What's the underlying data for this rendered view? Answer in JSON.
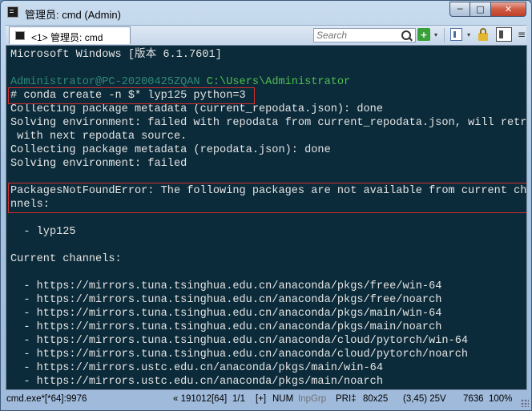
{
  "window": {
    "title": "管理员: cmd (Admin)",
    "controls": {
      "minimize": "─",
      "maximize": "□",
      "close": "✕"
    }
  },
  "toolbar": {
    "tab_label": "<1> 管理员: cmd",
    "search_placeholder": "Search",
    "add_label": "+",
    "dropdown_glyph": "▾",
    "menu_glyph": "≡"
  },
  "console": {
    "header": "Microsoft Windows [版本 6.1.7601]",
    "prompt_user": "Administrator@PC-20200425ZQAN",
    "prompt_path": "C:\\Users\\Administrator",
    "command": "# conda create -n $* lyp125 python=3",
    "output": [
      "Collecting package metadata (current_repodata.json): done",
      "Solving environment: failed with repodata from current_repodata.json, will retry",
      " with next repodata source.",
      "Collecting package metadata (repodata.json): done",
      "Solving environment: failed"
    ],
    "error_lines": [
      "PackagesNotFoundError: The following packages are not available from current cha",
      "nnels:"
    ],
    "missing_package": "  - lyp125",
    "channels_header": "Current channels:",
    "channels": [
      "  - https://mirrors.tuna.tsinghua.edu.cn/anaconda/pkgs/free/win-64",
      "  - https://mirrors.tuna.tsinghua.edu.cn/anaconda/pkgs/free/noarch",
      "  - https://mirrors.tuna.tsinghua.edu.cn/anaconda/pkgs/main/win-64",
      "  - https://mirrors.tuna.tsinghua.edu.cn/anaconda/pkgs/main/noarch",
      "  - https://mirrors.tuna.tsinghua.edu.cn/anaconda/cloud/pytorch/win-64",
      "  - https://mirrors.tuna.tsinghua.edu.cn/anaconda/cloud/pytorch/noarch",
      "  - https://mirrors.ustc.edu.cn/anaconda/pkgs/main/win-64",
      "  - https://mirrors.ustc.edu.cn/anaconda/pkgs/main/noarch"
    ]
  },
  "statusbar": {
    "process": "cmd.exe*[*64]:9976",
    "build": "« 191012[64]",
    "pages": "1/1",
    "insert": "[+]",
    "numlock": "NUM",
    "inpgrp": "InpGrp",
    "pri": "PRI‡",
    "size": "80x25",
    "cursor": "(3,45) 25V",
    "pid": "7636",
    "zoom": "100%"
  },
  "colors": {
    "console_bg": "#0c2b3a",
    "console_text": "#e4e4e4",
    "prompt_user": "#2f8a77",
    "prompt_path": "#4fbf4f",
    "highlight_box": "#d12d2d"
  }
}
